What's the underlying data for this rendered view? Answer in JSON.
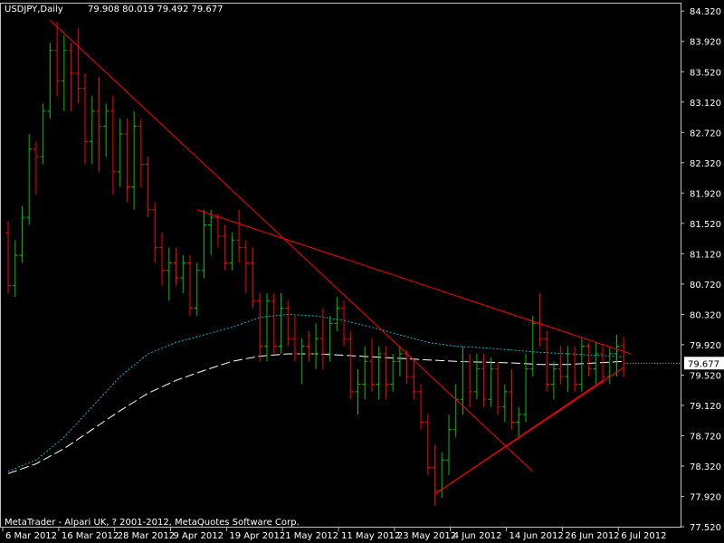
{
  "header": {
    "symbol_label": "USDJPY,Daily",
    "ohlc_text": "79.908 80.019 79.492 79.677"
  },
  "footer": {
    "copyright": "MetaTrader - Alpari UK, ? 2001-2012, MetaQuotes Software Corp."
  },
  "colors": {
    "background": "#000000",
    "frame": "#c0c0c0",
    "up_bar": "#00c000",
    "down_bar": "#ff0000",
    "trendline": "#ff0000",
    "ma_fast": "#00bcd4",
    "ma_slow": "#ffffff",
    "price_tag_bg": "#ffffff",
    "text": "#ffffff"
  },
  "chart_data": {
    "type": "ohlc",
    "title": "USDJPY,Daily",
    "ylim": [
      77.52,
      84.43
    ],
    "y_ticks": [
      "84.320",
      "83.920",
      "83.520",
      "83.120",
      "82.720",
      "82.320",
      "81.920",
      "81.520",
      "81.120",
      "80.720",
      "80.320",
      "79.920",
      "79.520",
      "79.120",
      "78.720",
      "78.320",
      "77.920",
      "77.520"
    ],
    "x_ticks": [
      "6 Mar 2012",
      "16 Mar 2012",
      "28 Mar 2012",
      "9 Apr 2012",
      "19 Apr 2012",
      "1 May 2012",
      "11 May 2012",
      "23 May 2012",
      "4 Jun 2012",
      "14 Jun 2012",
      "26 Jun 2012",
      "6 Jul 2012"
    ],
    "x_tick_index": [
      0,
      8,
      16,
      24,
      32,
      40,
      48,
      56,
      64,
      72,
      80,
      88
    ],
    "current_price": "79.677",
    "bars": [
      {
        "o": 81.4,
        "h": 81.55,
        "l": 80.6,
        "c": 80.7
      },
      {
        "o": 80.7,
        "h": 81.3,
        "l": 80.55,
        "c": 81.1
      },
      {
        "o": 81.1,
        "h": 81.75,
        "l": 81.0,
        "c": 81.6
      },
      {
        "o": 81.6,
        "h": 82.7,
        "l": 81.5,
        "c": 82.5
      },
      {
        "o": 82.5,
        "h": 82.6,
        "l": 81.9,
        "c": 82.4
      },
      {
        "o": 82.4,
        "h": 83.1,
        "l": 82.3,
        "c": 83.0
      },
      {
        "o": 83.0,
        "h": 83.9,
        "l": 82.9,
        "c": 83.8
      },
      {
        "o": 83.8,
        "h": 84.18,
        "l": 83.2,
        "c": 83.4
      },
      {
        "o": 83.4,
        "h": 84.0,
        "l": 83.0,
        "c": 83.8
      },
      {
        "o": 83.8,
        "h": 83.9,
        "l": 83.0,
        "c": 83.5
      },
      {
        "o": 83.5,
        "h": 84.1,
        "l": 83.1,
        "c": 83.3
      },
      {
        "o": 83.3,
        "h": 83.5,
        "l": 82.3,
        "c": 82.6
      },
      {
        "o": 82.6,
        "h": 83.2,
        "l": 82.3,
        "c": 83.0
      },
      {
        "o": 83.0,
        "h": 83.45,
        "l": 82.2,
        "c": 82.8
      },
      {
        "o": 82.8,
        "h": 83.1,
        "l": 82.4,
        "c": 83.0
      },
      {
        "o": 83.0,
        "h": 83.2,
        "l": 81.9,
        "c": 82.2
      },
      {
        "o": 82.2,
        "h": 82.9,
        "l": 82.0,
        "c": 82.7
      },
      {
        "o": 82.7,
        "h": 82.9,
        "l": 81.8,
        "c": 82.0
      },
      {
        "o": 82.0,
        "h": 83.0,
        "l": 81.7,
        "c": 82.8
      },
      {
        "o": 82.8,
        "h": 82.9,
        "l": 82.0,
        "c": 82.3
      },
      {
        "o": 82.3,
        "h": 82.4,
        "l": 81.6,
        "c": 81.7
      },
      {
        "o": 81.7,
        "h": 81.8,
        "l": 81.0,
        "c": 81.2
      },
      {
        "o": 81.2,
        "h": 81.4,
        "l": 80.7,
        "c": 80.9
      },
      {
        "o": 80.9,
        "h": 81.2,
        "l": 80.5,
        "c": 81.0
      },
      {
        "o": 81.0,
        "h": 81.2,
        "l": 80.7,
        "c": 80.8
      },
      {
        "o": 80.8,
        "h": 81.1,
        "l": 80.6,
        "c": 81.0
      },
      {
        "o": 81.0,
        "h": 81.1,
        "l": 80.3,
        "c": 80.4
      },
      {
        "o": 80.4,
        "h": 81.0,
        "l": 80.3,
        "c": 80.9
      },
      {
        "o": 80.9,
        "h": 81.7,
        "l": 80.8,
        "c": 81.5
      },
      {
        "o": 81.5,
        "h": 81.7,
        "l": 81.1,
        "c": 81.6
      },
      {
        "o": 81.6,
        "h": 81.65,
        "l": 81.2,
        "c": 81.35
      },
      {
        "o": 81.35,
        "h": 81.5,
        "l": 80.9,
        "c": 81.0
      },
      {
        "o": 81.0,
        "h": 81.4,
        "l": 80.9,
        "c": 81.3
      },
      {
        "o": 81.3,
        "h": 81.7,
        "l": 81.0,
        "c": 81.2
      },
      {
        "o": 81.2,
        "h": 81.3,
        "l": 80.6,
        "c": 81.0
      },
      {
        "o": 81.0,
        "h": 81.2,
        "l": 80.4,
        "c": 80.5
      },
      {
        "o": 80.5,
        "h": 80.6,
        "l": 79.7,
        "c": 79.9
      },
      {
        "o": 79.9,
        "h": 80.6,
        "l": 79.7,
        "c": 80.5
      },
      {
        "o": 80.5,
        "h": 80.6,
        "l": 79.8,
        "c": 79.9
      },
      {
        "o": 79.9,
        "h": 80.6,
        "l": 79.8,
        "c": 80.4
      },
      {
        "o": 80.4,
        "h": 80.5,
        "l": 79.9,
        "c": 80.0
      },
      {
        "o": 80.0,
        "h": 80.3,
        "l": 79.7,
        "c": 79.8
      },
      {
        "o": 79.8,
        "h": 80.0,
        "l": 79.4,
        "c": 79.9
      },
      {
        "o": 79.9,
        "h": 80.1,
        "l": 79.7,
        "c": 79.8
      },
      {
        "o": 79.8,
        "h": 80.2,
        "l": 79.6,
        "c": 80.0
      },
      {
        "o": 80.0,
        "h": 80.4,
        "l": 79.6,
        "c": 79.8
      },
      {
        "o": 79.8,
        "h": 80.3,
        "l": 79.7,
        "c": 80.2
      },
      {
        "o": 80.2,
        "h": 80.55,
        "l": 80.1,
        "c": 80.4
      },
      {
        "o": 80.4,
        "h": 80.5,
        "l": 79.9,
        "c": 80.0
      },
      {
        "o": 80.0,
        "h": 80.1,
        "l": 79.2,
        "c": 79.3
      },
      {
        "o": 79.3,
        "h": 79.6,
        "l": 79.0,
        "c": 79.4
      },
      {
        "o": 79.4,
        "h": 79.9,
        "l": 79.2,
        "c": 79.7
      },
      {
        "o": 79.7,
        "h": 80.0,
        "l": 79.3,
        "c": 79.4
      },
      {
        "o": 79.4,
        "h": 79.9,
        "l": 79.2,
        "c": 79.8
      },
      {
        "o": 79.8,
        "h": 79.9,
        "l": 79.2,
        "c": 79.4
      },
      {
        "o": 79.4,
        "h": 79.8,
        "l": 79.3,
        "c": 79.7
      },
      {
        "o": 79.7,
        "h": 79.9,
        "l": 79.5,
        "c": 79.8
      },
      {
        "o": 79.8,
        "h": 79.85,
        "l": 79.4,
        "c": 79.5
      },
      {
        "o": 79.5,
        "h": 79.7,
        "l": 79.2,
        "c": 79.3
      },
      {
        "o": 79.3,
        "h": 79.4,
        "l": 78.8,
        "c": 78.9
      },
      {
        "o": 78.9,
        "h": 79.0,
        "l": 78.2,
        "c": 78.3
      },
      {
        "o": 78.3,
        "h": 78.6,
        "l": 77.8,
        "c": 78.0
      },
      {
        "o": 78.0,
        "h": 78.5,
        "l": 77.9,
        "c": 78.4
      },
      {
        "o": 78.4,
        "h": 79.0,
        "l": 78.2,
        "c": 78.8
      },
      {
        "o": 78.8,
        "h": 79.4,
        "l": 78.7,
        "c": 79.2
      },
      {
        "o": 79.2,
        "h": 79.9,
        "l": 79.0,
        "c": 79.7
      },
      {
        "o": 79.7,
        "h": 79.8,
        "l": 79.1,
        "c": 79.3
      },
      {
        "o": 79.3,
        "h": 79.8,
        "l": 79.2,
        "c": 79.6
      },
      {
        "o": 79.6,
        "h": 79.8,
        "l": 79.1,
        "c": 79.2
      },
      {
        "o": 79.2,
        "h": 79.75,
        "l": 79.1,
        "c": 79.6
      },
      {
        "o": 79.6,
        "h": 79.7,
        "l": 79.0,
        "c": 79.1
      },
      {
        "o": 79.1,
        "h": 79.4,
        "l": 78.9,
        "c": 79.3
      },
      {
        "o": 79.3,
        "h": 79.6,
        "l": 78.8,
        "c": 78.9
      },
      {
        "o": 78.9,
        "h": 79.1,
        "l": 78.7,
        "c": 79.0
      },
      {
        "o": 79.0,
        "h": 79.8,
        "l": 78.9,
        "c": 79.6
      },
      {
        "o": 79.6,
        "h": 80.3,
        "l": 79.5,
        "c": 80.2
      },
      {
        "o": 80.2,
        "h": 80.6,
        "l": 79.9,
        "c": 80.0
      },
      {
        "o": 80.0,
        "h": 80.1,
        "l": 79.3,
        "c": 79.4
      },
      {
        "o": 79.4,
        "h": 79.7,
        "l": 79.2,
        "c": 79.6
      },
      {
        "o": 79.6,
        "h": 79.9,
        "l": 79.4,
        "c": 79.5
      },
      {
        "o": 79.5,
        "h": 79.9,
        "l": 79.3,
        "c": 79.8
      },
      {
        "o": 79.8,
        "h": 79.9,
        "l": 79.3,
        "c": 79.4
      },
      {
        "o": 79.4,
        "h": 80.0,
        "l": 79.3,
        "c": 79.9
      },
      {
        "o": 79.9,
        "h": 79.95,
        "l": 79.5,
        "c": 79.6
      },
      {
        "o": 79.6,
        "h": 79.95,
        "l": 79.4,
        "c": 79.8
      },
      {
        "o": 79.8,
        "h": 79.9,
        "l": 79.4,
        "c": 79.5
      },
      {
        "o": 79.5,
        "h": 79.9,
        "l": 79.4,
        "c": 79.8
      },
      {
        "o": 79.8,
        "h": 80.05,
        "l": 79.5,
        "c": 79.9
      },
      {
        "o": 79.908,
        "h": 80.019,
        "l": 79.492,
        "c": 79.677
      }
    ],
    "ma_fast": [
      [
        0,
        78.25
      ],
      [
        4,
        78.4
      ],
      [
        8,
        78.7
      ],
      [
        12,
        79.1
      ],
      [
        16,
        79.5
      ],
      [
        20,
        79.8
      ],
      [
        24,
        79.95
      ],
      [
        28,
        80.05
      ],
      [
        32,
        80.15
      ],
      [
        36,
        80.28
      ],
      [
        40,
        80.32
      ],
      [
        44,
        80.3
      ],
      [
        48,
        80.24
      ],
      [
        52,
        80.15
      ],
      [
        56,
        80.05
      ],
      [
        60,
        79.95
      ],
      [
        64,
        79.9
      ],
      [
        68,
        79.88
      ],
      [
        72,
        79.85
      ],
      [
        76,
        79.82
      ],
      [
        80,
        79.8
      ],
      [
        84,
        79.78
      ],
      [
        88,
        79.76
      ]
    ],
    "ma_slow": [
      [
        0,
        78.22
      ],
      [
        4,
        78.35
      ],
      [
        8,
        78.55
      ],
      [
        12,
        78.8
      ],
      [
        16,
        79.05
      ],
      [
        20,
        79.28
      ],
      [
        24,
        79.45
      ],
      [
        28,
        79.58
      ],
      [
        32,
        79.7
      ],
      [
        36,
        79.77
      ],
      [
        40,
        79.8
      ],
      [
        44,
        79.8
      ],
      [
        48,
        79.78
      ],
      [
        52,
        79.76
      ],
      [
        56,
        79.74
      ],
      [
        60,
        79.72
      ],
      [
        64,
        79.7
      ],
      [
        68,
        79.69
      ],
      [
        72,
        79.68
      ],
      [
        76,
        79.66
      ],
      [
        80,
        79.66
      ],
      [
        84,
        79.68
      ],
      [
        88,
        79.7
      ]
    ],
    "trendlines": [
      {
        "x1": 6,
        "y1": 84.2,
        "x2": 75,
        "y2": 78.25
      },
      {
        "x1": 27,
        "y1": 81.7,
        "x2": 89,
        "y2": 79.8
      },
      {
        "x1": 61,
        "y1": 77.95,
        "x2": 85,
        "y2": 79.45
      },
      {
        "x1": 61,
        "y1": 77.95,
        "x2": 88,
        "y2": 79.62
      }
    ]
  }
}
